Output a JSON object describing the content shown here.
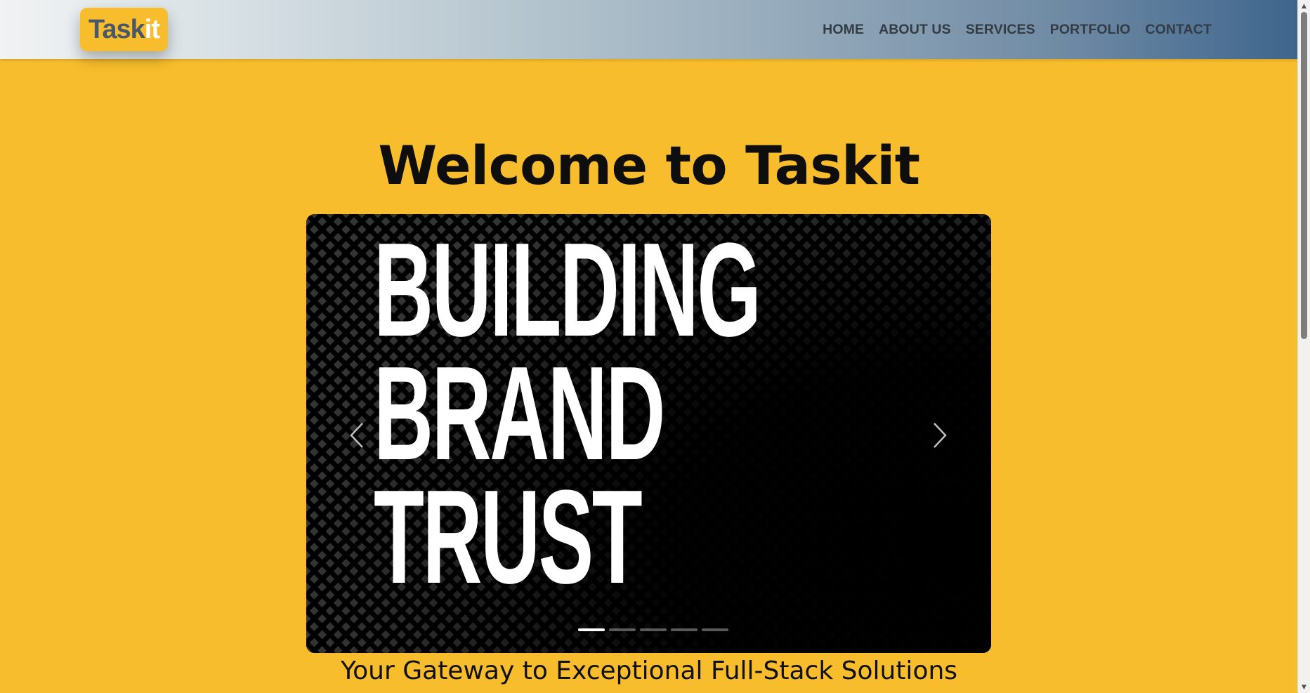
{
  "header": {
    "logo": {
      "prefix": "Task",
      "highlight": "it"
    },
    "nav": [
      "HOME",
      "ABOUT US",
      "SERVICES",
      "PORTFOLIO",
      "CONTACT"
    ]
  },
  "hero": {
    "title": "Welcome to Taskit",
    "carousel": {
      "slide_lines": [
        "BUILDING",
        "BRAND",
        "TRUST"
      ],
      "slide_count": 5,
      "active_index": 0,
      "prev_icon": "chevron-left-icon",
      "next_icon": "chevron-right-icon"
    },
    "tagline": "Your Gateway to Exceptional Full-Stack Solutions"
  },
  "colors": {
    "background": "#f8bd2c",
    "header_start": "#f1f3f3",
    "header_end": "#3e658c",
    "nav_text": "#333b45",
    "slide_bg": "#000000",
    "slide_text": "#ffffff"
  }
}
